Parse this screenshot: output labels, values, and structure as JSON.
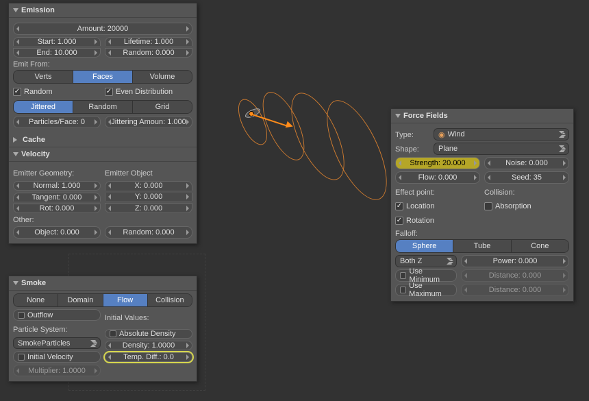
{
  "emission": {
    "title": "Emission",
    "amount_label": "Amount: 20000",
    "start_label": "Start: 1.000",
    "end_label": "End: 10.000",
    "lifetime_label": "Lifetime: 1.000",
    "random_label": "Random: 0.000",
    "emit_from_label": "Emit From:",
    "emit_from_options": [
      "Verts",
      "Faces",
      "Volume"
    ],
    "random_check": "Random",
    "even_dist_check": "Even Distribution",
    "dist_options": [
      "Jittered",
      "Random",
      "Grid"
    ],
    "particles_face_label": "Particles/Face: 0",
    "jittering_label": "Jittering Amoun: 1.000"
  },
  "cache": {
    "title": "Cache"
  },
  "velocity": {
    "title": "Velocity",
    "emitter_geom_label": "Emitter Geometry:",
    "normal_label": "Normal: 1.000",
    "tangent_label": "Tangent: 0.000",
    "rot_label": "Rot: 0.000",
    "emitter_obj_label": "Emitter Object",
    "x_label": "X: 0.000",
    "y_label": "Y: 0.000",
    "z_label": "Z: 0.000",
    "other_label": "Other:",
    "object_label": "Object: 0.000",
    "random_vel_label": "Random: 0.000"
  },
  "smoke": {
    "title": "Smoke",
    "type_options": [
      "None",
      "Domain",
      "Flow",
      "Collision"
    ],
    "outflow_label": "Outflow",
    "initial_values_label": "Initial Values:",
    "particle_system_label": "Particle System:",
    "absolute_density_label": "Absolute Density",
    "psys_value": "SmokeParticles",
    "density_label": "Density: 1.0000",
    "initial_velocity_label": "Initial Velocity",
    "temp_diff_label": "Temp. Diff.: 0.0",
    "multiplier_label": "Multiplier: 1.0000"
  },
  "force": {
    "title": "Force Fields",
    "type_label": "Type:",
    "type_value": "Wind",
    "shape_label": "Shape:",
    "shape_value": "Plane",
    "strength_label": "Strength: 20.000",
    "noise_label": "Noise: 0.000",
    "flow_label": "Flow: 0.000",
    "seed_label": "Seed: 35",
    "effect_point_label": "Effect point:",
    "collision_label": "Collision:",
    "location_check": "Location",
    "absorption_check": "Absorption",
    "rotation_check": "Rotation",
    "falloff_label": "Falloff:",
    "falloff_options": [
      "Sphere",
      "Tube",
      "Cone"
    ],
    "bothz_value": "Both Z",
    "power_label": "Power: 0.000",
    "use_min_label": "Use Minimum",
    "use_max_label": "Use Maximum",
    "distance_min_label": "Distance: 0.000",
    "distance_max_label": "Distance: 0.000"
  }
}
